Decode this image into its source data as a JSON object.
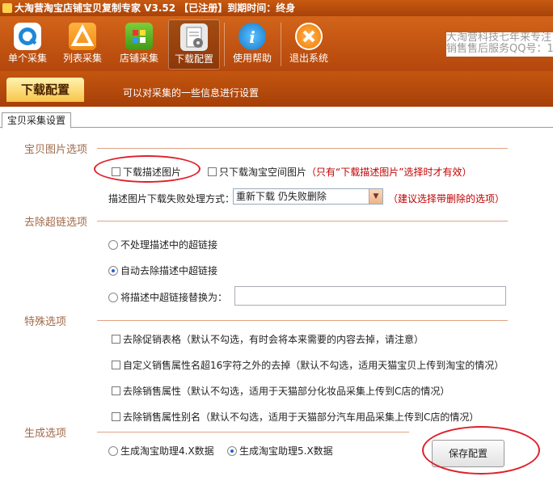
{
  "window": {
    "title": "大淘营淘宝店铺宝贝复制专家 V3.52 【已注册】到期时间：终身"
  },
  "toolbar": {
    "items": [
      {
        "label": "单个采集",
        "icon": "magnifier-icon"
      },
      {
        "label": "列表采集",
        "icon": "list-triangle-icon"
      },
      {
        "label": "店铺采集",
        "icon": "shop-grid-icon"
      },
      {
        "label": "下载配置",
        "icon": "download-config-icon"
      },
      {
        "label": "使用帮助",
        "icon": "info-icon"
      },
      {
        "label": "退出系统",
        "icon": "close-icon"
      }
    ]
  },
  "promo": {
    "line1": "大淘营科技七年来专注",
    "line2": "销售售后服务QQ号：1"
  },
  "subbar": {
    "tab": "下载配置",
    "description": "可以对采集的一些信息进行设置"
  },
  "tabs": [
    {
      "label": "宝贝采集设置"
    }
  ],
  "image_options": {
    "title": "宝贝图片选项",
    "download_desc_images": "下载描述图片",
    "download_desc_images_checked": false,
    "only_taobao_space": "只下载淘宝空间图片",
    "only_taobao_space_checked": false,
    "only_taobao_space_note": "（只有“下载描述图片”选择时才有效）",
    "fail_label": "描述图片下载失败处理方式：",
    "fail_value": "重新下载 仍失败删除",
    "fail_note": "（建议选择带删除的选项）"
  },
  "hyperlink_options": {
    "title": "去除超链选项",
    "options": [
      {
        "label": "不处理描述中的超链接",
        "selected": false
      },
      {
        "label": "自动去除描述中超链接",
        "selected": true
      },
      {
        "label": "将描述中超链接替换为：",
        "selected": false
      }
    ],
    "replace_value": ""
  },
  "special_options": {
    "title": "特殊选项",
    "items": [
      {
        "label": "去除促销表格（默认不勾选，有时会将本来需要的内容去掉，请注意）",
        "checked": false
      },
      {
        "label": "自定义销售属性名超16字符之外的去掉（默认不勾选，适用天猫宝贝上传到淘宝的情况）",
        "checked": false
      },
      {
        "label": "去除销售属性（默认不勾选，适用于天猫部分化妆品采集上传到C店的情况）",
        "checked": false
      },
      {
        "label": "去除销售属性别名（默认不勾选，适用于天猫部分汽车用品采集上传到C店的情况）",
        "checked": false
      }
    ]
  },
  "generate_options": {
    "title": "生成选项",
    "options": [
      {
        "label": "生成淘宝助理4.X数据",
        "selected": false
      },
      {
        "label": "生成淘宝助理5.X数据",
        "selected": true
      }
    ],
    "save_button": "保存配置"
  },
  "colors": {
    "toolbar_orange": "#b4470c",
    "section_text": "#a06a4a",
    "note_red": "#c00000",
    "highlight_ellipse": "#e0202a"
  }
}
